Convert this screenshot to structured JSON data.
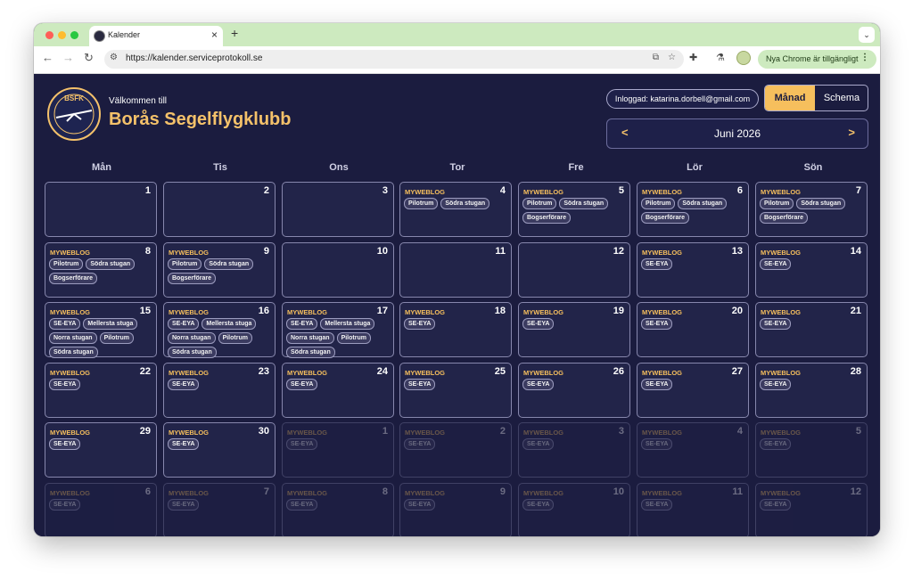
{
  "browser": {
    "tab_title": "Kalender",
    "new_tab_glyph": "+",
    "url": "https://kalender.serviceprotokoll.se",
    "update_label": "Nya Chrome är tillgängligt"
  },
  "header": {
    "logo_text": "BSFK",
    "welcome": "Välkommen till",
    "club_name": "Borås Segelflygklubb",
    "login_label": "Inloggad: katarina.dorbell@gmail.com",
    "view_month": "Månad",
    "view_schema": "Schema",
    "month_label": "Juni 2026",
    "prev_glyph": "<",
    "next_glyph": ">"
  },
  "colors": {
    "page_bg": "#1b1c3f",
    "accent": "#f6bf5d",
    "cell_bg": "#222449"
  },
  "weekdays": [
    "Mån",
    "Tis",
    "Ons",
    "Tor",
    "Fre",
    "Lör",
    "Sön"
  ],
  "calendar": {
    "days": [
      {
        "day": "1",
        "event": "",
        "chips": [],
        "current": true
      },
      {
        "day": "2",
        "event": "",
        "chips": [],
        "current": true
      },
      {
        "day": "3",
        "event": "",
        "chips": [],
        "current": true
      },
      {
        "day": "4",
        "event": "MYWEBLOG",
        "chips": [
          "Pilotrum",
          "Södra stugan"
        ],
        "current": true
      },
      {
        "day": "5",
        "event": "MYWEBLOG",
        "chips": [
          "Pilotrum",
          "Södra stugan",
          "Bogserförare"
        ],
        "current": true
      },
      {
        "day": "6",
        "event": "MYWEBLOG",
        "chips": [
          "Pilotrum",
          "Södra stugan",
          "Bogserförare"
        ],
        "current": true
      },
      {
        "day": "7",
        "event": "MYWEBLOG",
        "chips": [
          "Pilotrum",
          "Södra stugan",
          "Bogserförare"
        ],
        "current": true
      },
      {
        "day": "8",
        "event": "MYWEBLOG",
        "chips": [
          "Pilotrum",
          "Södra stugan",
          "Bogserförare"
        ],
        "current": true
      },
      {
        "day": "9",
        "event": "MYWEBLOG",
        "chips": [
          "Pilotrum",
          "Södra stugan",
          "Bogserförare"
        ],
        "current": true
      },
      {
        "day": "10",
        "event": "",
        "chips": [],
        "current": true
      },
      {
        "day": "11",
        "event": "",
        "chips": [],
        "current": true
      },
      {
        "day": "12",
        "event": "",
        "chips": [],
        "current": true
      },
      {
        "day": "13",
        "event": "MYWEBLOG",
        "chips": [
          "SE-EYA"
        ],
        "current": true
      },
      {
        "day": "14",
        "event": "MYWEBLOG",
        "chips": [
          "SE-EYA"
        ],
        "current": true
      },
      {
        "day": "15",
        "event": "MYWEBLOG",
        "chips": [
          "SE-EYA",
          "Mellersta stuga",
          "Norra stugan",
          "Pilotrum",
          "Södra stugan"
        ],
        "current": true
      },
      {
        "day": "16",
        "event": "MYWEBLOG",
        "chips": [
          "SE-EYA",
          "Mellersta stuga",
          "Norra stugan",
          "Pilotrum",
          "Södra stugan"
        ],
        "current": true
      },
      {
        "day": "17",
        "event": "MYWEBLOG",
        "chips": [
          "SE-EYA",
          "Mellersta stuga",
          "Norra stugan",
          "Pilotrum",
          "Södra stugan"
        ],
        "current": true
      },
      {
        "day": "18",
        "event": "MYWEBLOG",
        "chips": [
          "SE-EYA"
        ],
        "current": true
      },
      {
        "day": "19",
        "event": "MYWEBLOG",
        "chips": [
          "SE-EYA"
        ],
        "current": true
      },
      {
        "day": "20",
        "event": "MYWEBLOG",
        "chips": [
          "SE-EYA"
        ],
        "current": true
      },
      {
        "day": "21",
        "event": "MYWEBLOG",
        "chips": [
          "SE-EYA"
        ],
        "current": true
      },
      {
        "day": "22",
        "event": "MYWEBLOG",
        "chips": [
          "SE-EYA"
        ],
        "current": true
      },
      {
        "day": "23",
        "event": "MYWEBLOG",
        "chips": [
          "SE-EYA"
        ],
        "current": true
      },
      {
        "day": "24",
        "event": "MYWEBLOG",
        "chips": [
          "SE-EYA"
        ],
        "current": true
      },
      {
        "day": "25",
        "event": "MYWEBLOG",
        "chips": [
          "SE-EYA"
        ],
        "current": true
      },
      {
        "day": "26",
        "event": "MYWEBLOG",
        "chips": [
          "SE-EYA"
        ],
        "current": true
      },
      {
        "day": "27",
        "event": "MYWEBLOG",
        "chips": [
          "SE-EYA"
        ],
        "current": true
      },
      {
        "day": "28",
        "event": "MYWEBLOG",
        "chips": [
          "SE-EYA"
        ],
        "current": true
      },
      {
        "day": "29",
        "event": "MYWEBLOG",
        "chips": [
          "SE-EYA"
        ],
        "current": true
      },
      {
        "day": "30",
        "event": "MYWEBLOG",
        "chips": [
          "SE-EYA"
        ],
        "current": true
      },
      {
        "day": "1",
        "event": "MYWEBLOG",
        "chips": [
          "SE-EYA"
        ],
        "current": false
      },
      {
        "day": "2",
        "event": "MYWEBLOG",
        "chips": [
          "SE-EYA"
        ],
        "current": false
      },
      {
        "day": "3",
        "event": "MYWEBLOG",
        "chips": [
          "SE-EYA"
        ],
        "current": false
      },
      {
        "day": "4",
        "event": "MYWEBLOG",
        "chips": [
          "SE-EYA"
        ],
        "current": false
      },
      {
        "day": "5",
        "event": "MYWEBLOG",
        "chips": [
          "SE-EYA"
        ],
        "current": false
      },
      {
        "day": "6",
        "event": "MYWEBLOG",
        "chips": [
          "SE-EYA"
        ],
        "current": false
      },
      {
        "day": "7",
        "event": "MYWEBLOG",
        "chips": [
          "SE-EYA"
        ],
        "current": false
      },
      {
        "day": "8",
        "event": "MYWEBLOG",
        "chips": [
          "SE-EYA"
        ],
        "current": false
      },
      {
        "day": "9",
        "event": "MYWEBLOG",
        "chips": [
          "SE-EYA"
        ],
        "current": false
      },
      {
        "day": "10",
        "event": "MYWEBLOG",
        "chips": [
          "SE-EYA"
        ],
        "current": false
      },
      {
        "day": "11",
        "event": "MYWEBLOG",
        "chips": [
          "SE-EYA"
        ],
        "current": false
      },
      {
        "day": "12",
        "event": "MYWEBLOG",
        "chips": [
          "SE-EYA"
        ],
        "current": false
      }
    ]
  }
}
